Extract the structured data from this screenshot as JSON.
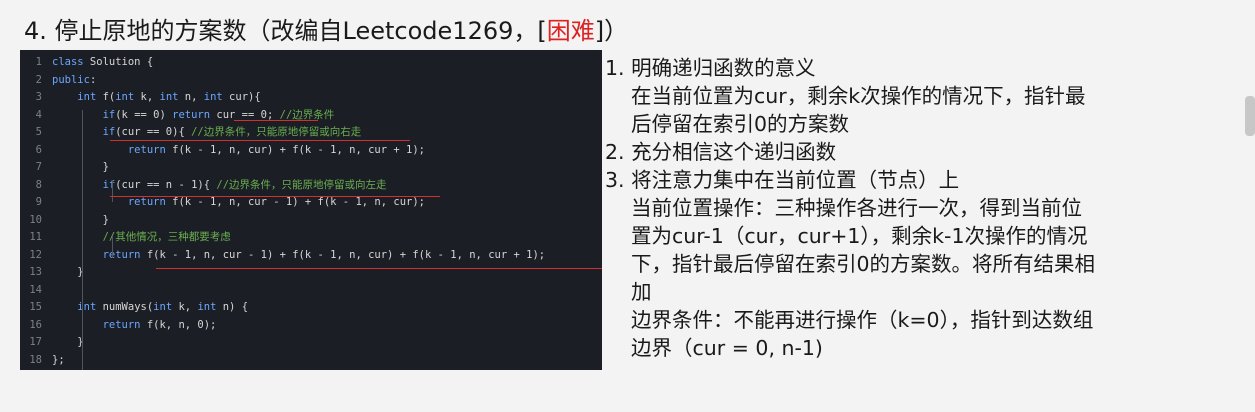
{
  "title": {
    "prefix": "4. 停止原地的方案数（改编自Leetcode1269，[",
    "difficulty": "困难",
    "suffix": "]）"
  },
  "code_lines": [
    {
      "n": "1",
      "text": "class Solution {"
    },
    {
      "n": "2",
      "text": "public:"
    },
    {
      "n": "3",
      "text": "    int f(int k, int n, int cur){"
    },
    {
      "n": "4",
      "text": "        if(k == 0) return cur == 0; //边界条件"
    },
    {
      "n": "5",
      "text": "        if(cur == 0){ //边界条件，只能原地停留或向右走"
    },
    {
      "n": "6",
      "text": "            return f(k - 1, n, cur) + f(k - 1, n, cur + 1);"
    },
    {
      "n": "7",
      "text": "        }"
    },
    {
      "n": "8",
      "text": "        if(cur == n - 1){ //边界条件，只能原地停留或向左走"
    },
    {
      "n": "9",
      "text": "            return f(k - 1, n, cur - 1) + f(k - 1, n, cur);"
    },
    {
      "n": "10",
      "text": "        }"
    },
    {
      "n": "11",
      "text": "        //其他情况，三种都要考虑"
    },
    {
      "n": "12",
      "text": "        return f(k - 1, n, cur - 1) + f(k - 1, n, cur) + f(k - 1, n, cur + 1);"
    },
    {
      "n": "13",
      "text": "    }"
    },
    {
      "n": "14",
      "text": ""
    },
    {
      "n": "15",
      "text": "    int numWays(int k, int n) {"
    },
    {
      "n": "16",
      "text": "        return f(k, n, 0);"
    },
    {
      "n": "17",
      "text": "    }"
    },
    {
      "n": "18",
      "text": "};"
    }
  ],
  "notes": {
    "p1": "1. 明确递归函数的意义",
    "p1a": "在当前位置为cur，剩余k次操作的情况下，指针最",
    "p1b": "后停留在索引0的方案数",
    "p2": "2. 充分相信这个递归函数",
    "p3": "3. 将注意力集中在当前位置（节点）上",
    "p3a": "当前位置操作：三种操作各进行一次，得到当前位",
    "p3b": "置为cur-1（cur，cur+1），剩余k-1次操作的情况",
    "p3c": "下，指针最后停留在索引0的方案数。将所有结果相",
    "p3d": "加",
    "p3e": "边界条件：不能再进行操作（k=0），指针到达数组",
    "p3f": "边界（cur = 0, n-1)"
  }
}
